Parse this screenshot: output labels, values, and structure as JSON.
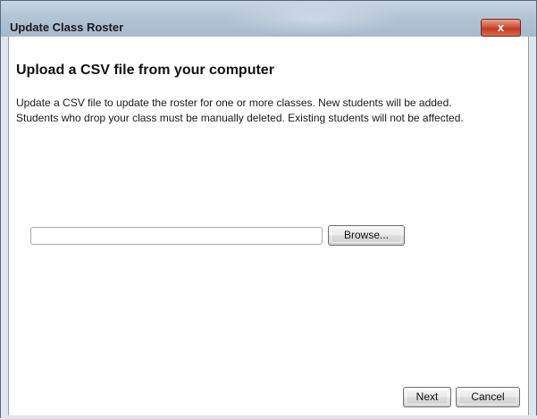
{
  "window": {
    "title": "Update Class Roster",
    "close_label": "x"
  },
  "main": {
    "heading": "Upload a CSV file from your computer",
    "description_line1": "Update a CSV file to update the roster for one or more classes. New students will be added.",
    "description_line2": "Students who drop your class must be manually deleted. Existing students will not be affected."
  },
  "file_picker": {
    "value": "",
    "placeholder": "",
    "browse_label": "Browse..."
  },
  "footer": {
    "next_label": "Next",
    "cancel_label": "Cancel"
  }
}
